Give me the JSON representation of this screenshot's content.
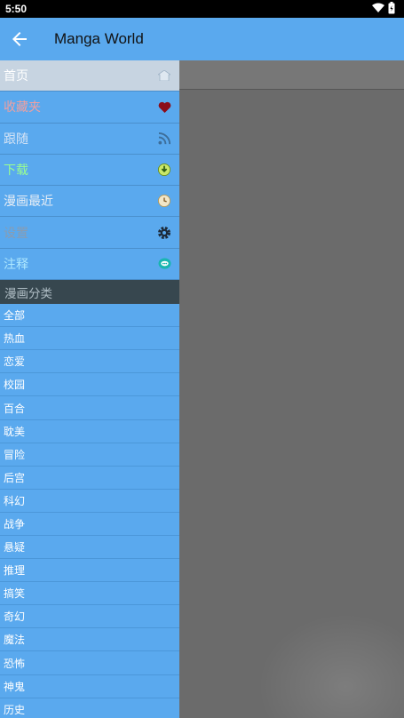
{
  "status": {
    "time": "5:50"
  },
  "app": {
    "title": "Manga World"
  },
  "nav": [
    {
      "label": "首页",
      "color": "#ffffff",
      "icon": "home-icon"
    },
    {
      "label": "收藏夹",
      "color": "#f0a0a0",
      "icon": "heart-icon"
    },
    {
      "label": "跟随",
      "color": "#d6e4f5",
      "icon": "rss-icon"
    },
    {
      "label": "下载",
      "color": "#9aff8f",
      "icon": "download-icon"
    },
    {
      "label": "漫画最近",
      "color": "#e8eef5",
      "icon": "clock-icon"
    },
    {
      "label": "设置",
      "color": "#8a9cb0",
      "icon": "gear-icon"
    },
    {
      "label": "注释",
      "color": "#aee8ff",
      "icon": "comment-icon"
    }
  ],
  "categories_header": "漫画分类",
  "categories": [
    "全部",
    "热血",
    "恋爱",
    "校园",
    "百合",
    "耽美",
    "冒险",
    "后宫",
    "科幻",
    "战争",
    "悬疑",
    "推理",
    "搞笑",
    "奇幻",
    "魔法",
    "恐怖",
    "神鬼",
    "历史"
  ]
}
